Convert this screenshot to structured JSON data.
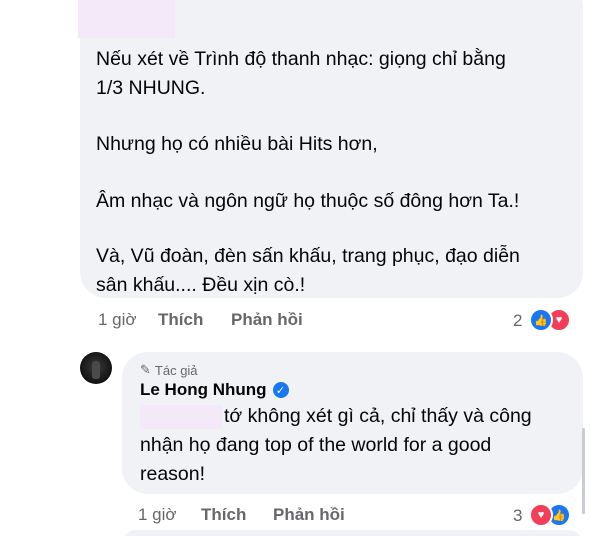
{
  "comment1": {
    "lines": [
      "Nếu xét về Trình độ thanh nhạc: giọng chỉ bằng",
      "1/3 NHUNG.",
      "Nhưng họ có nhiều bài Hits hơn,",
      "Âm nhạc và ngôn ngữ họ thuộc số đông hơn Ta.!",
      "Và, Vũ đoàn, đèn sấn khấu, trang phục, đạo diễn",
      "sân khấu.... Đều xịn cò.!"
    ],
    "time": "1 giờ",
    "like_label": "Thích",
    "reply_label": "Phản hồi",
    "reaction_count": "2",
    "reactions": [
      "like",
      "love"
    ]
  },
  "reply": {
    "badge_label": "Tác giả",
    "author": "Le Hong Nhung",
    "lines": [
      "tớ không xét gì cả, chỉ thấy và công",
      "nhận họ đang top of the world for a good",
      "reason!"
    ],
    "time": "1 giờ",
    "like_label": "Thích",
    "reply_label": "Phản hồi",
    "reaction_count": "3",
    "reactions": [
      "love",
      "like"
    ]
  },
  "colors": {
    "bubble": "#f0f2f5",
    "text": "#050505",
    "meta": "#65676b",
    "like": "#1877f2",
    "love": "#f33e58",
    "redaction": "#f4e9f8"
  }
}
